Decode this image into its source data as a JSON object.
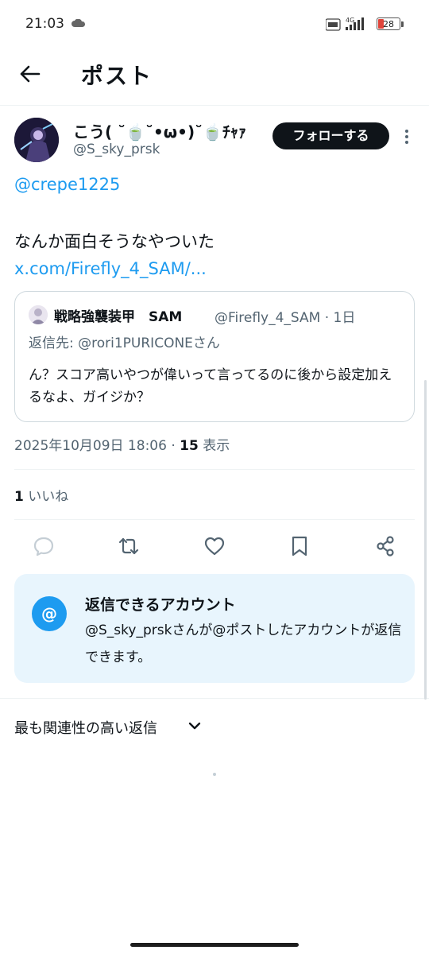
{
  "status_bar": {
    "time": "21:03",
    "network": "4G",
    "battery": "28"
  },
  "header": {
    "title": "ポスト"
  },
  "author": {
    "display_name": "こう( ˘🍵˘•ω•)˘🍵ﾁｬｧ",
    "handle": "@S_sky_prsk",
    "follow_label": "フォローする"
  },
  "post": {
    "mention": "@crepe1225",
    "text": "なんか面白そうなやついた",
    "link": "x.com/Firefly_4_SAM/..."
  },
  "quote": {
    "name": "戦略強襲装甲　SAM",
    "handle_time": "@Firefly_4_SAM · 1日",
    "reply_to": "返信先: @rori1PURICONEさん",
    "text": "ん？スコア高いやつが偉いって言ってるのに後から設定加えるなよ、ガイジか？"
  },
  "meta": {
    "timestamp": "2025年10月09日 18:06 · ",
    "views_count": "15",
    "views_label": " 表示",
    "likes_count": "1",
    "likes_label": " いいね"
  },
  "actions": {
    "reply_icon": "reply-icon",
    "retweet_icon": "retweet-icon",
    "like_icon": "heart-icon",
    "bookmark_icon": "bookmark-icon",
    "share_icon": "share-icon"
  },
  "reply_restriction": {
    "icon": "@",
    "title": "返信できるアカウント",
    "description": "@S_sky_prskさんが@ポストしたアカウントが返信できます。"
  },
  "replies": {
    "sort_label": "最も関連性の高い返信"
  },
  "colors": {
    "accent": "#1d9bf0",
    "text": "#0f1419",
    "muted": "#536471",
    "restrict_bg": "#e8f5fd"
  }
}
